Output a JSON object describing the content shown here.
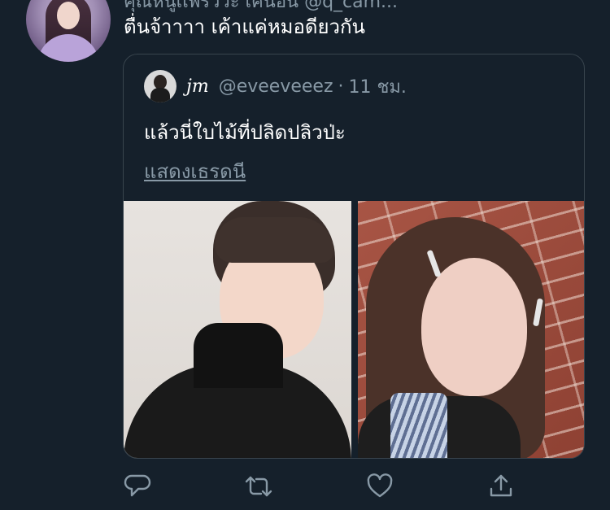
{
  "tweet": {
    "top_partial_text": "คุณหนูเเพรววะ เคนอน @q_cam...",
    "text": "ตื่นจ้าาาา เค้าแค่หมอดียวกัน"
  },
  "quote": {
    "name": "jm",
    "handle": "@eveeveeez",
    "separator": "·",
    "time": "11 ชม.",
    "text": "แล้วนี่ใบไม้ที่ปลิดปลิวป่ะ",
    "show_thread": "แสดงเธรดนี"
  },
  "actions": [
    {
      "icon": "reply-icon"
    },
    {
      "icon": "retweet-icon"
    },
    {
      "icon": "like-icon"
    },
    {
      "icon": "share-icon"
    }
  ],
  "colors": {
    "background": "#15202b",
    "secondary_text": "#8899a6",
    "card_border": "#38444d"
  }
}
